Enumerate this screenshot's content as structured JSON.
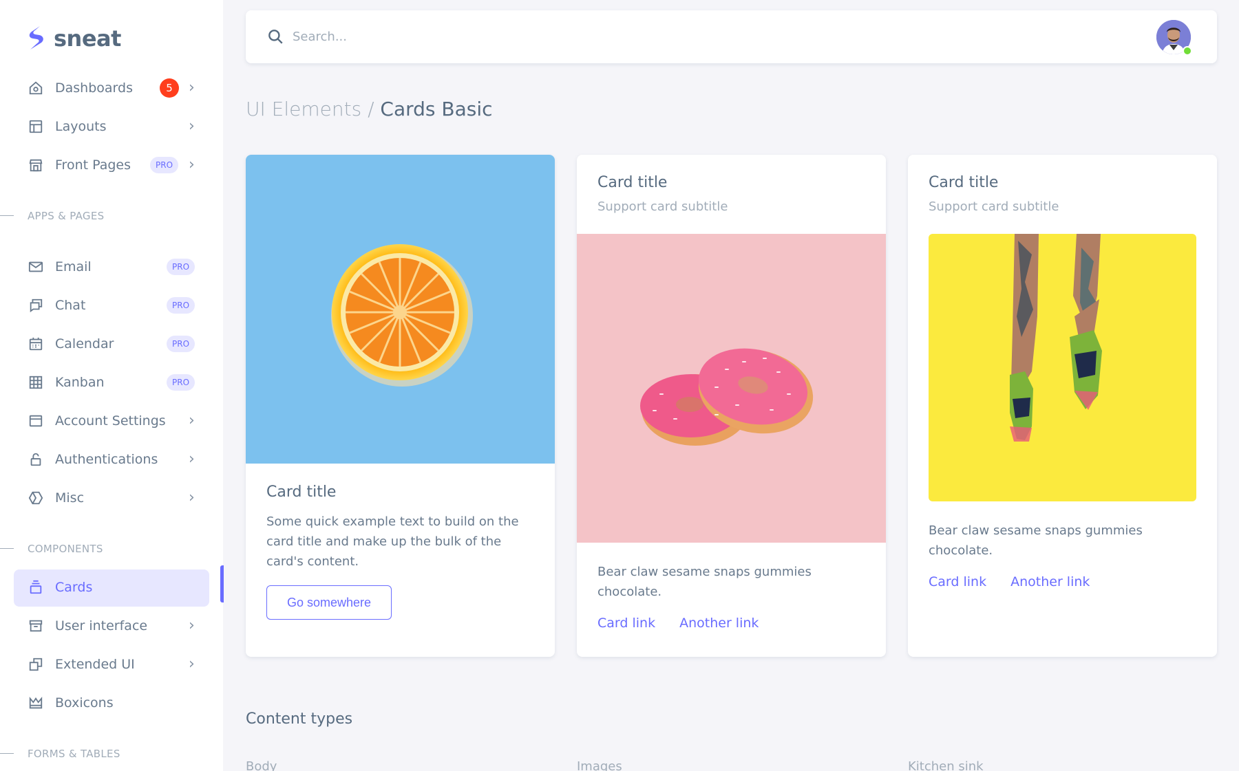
{
  "brand": {
    "name": "sneat",
    "color": "#696cff"
  },
  "search": {
    "placeholder": "Search..."
  },
  "breadcrumb": {
    "parent": "UI Elements /",
    "current": "Cards Basic"
  },
  "sidebar": {
    "group1": [
      {
        "label": "Dashboards",
        "icon": "home-icon",
        "badge": "5"
      },
      {
        "label": "Layouts",
        "icon": "layout-icon"
      },
      {
        "label": "Front Pages",
        "icon": "store-icon",
        "pro": "PRO"
      }
    ],
    "section_apps": "APPS & PAGES",
    "group2": [
      {
        "label": "Email",
        "icon": "envelope-icon",
        "pro": "PRO"
      },
      {
        "label": "Chat",
        "icon": "chat-icon",
        "pro": "PRO"
      },
      {
        "label": "Calendar",
        "icon": "calendar-icon",
        "pro": "PRO"
      },
      {
        "label": "Kanban",
        "icon": "grid-icon",
        "pro": "PRO"
      },
      {
        "label": "Account Settings",
        "icon": "window-icon"
      },
      {
        "label": "Authentications",
        "icon": "lock-icon"
      },
      {
        "label": "Misc",
        "icon": "cube-icon"
      }
    ],
    "section_components": "COMPONENTS",
    "group3": [
      {
        "label": "Cards",
        "icon": "cards-icon",
        "active": true
      },
      {
        "label": "User interface",
        "icon": "box-icon"
      },
      {
        "label": "Extended UI",
        "icon": "copy-icon"
      },
      {
        "label": "Boxicons",
        "icon": "crown-icon"
      }
    ],
    "section_forms": "FORMS & TABLES"
  },
  "cards": [
    {
      "title": "Card title",
      "text": "Some quick example text to build on the card title and make up the bulk of the card's content.",
      "button": "Go somewhere",
      "image": "orange-slice"
    },
    {
      "title": "Card title",
      "subtitle": "Support card subtitle",
      "text": "Bear claw sesame snaps gummies chocolate.",
      "link1": "Card link",
      "link2": "Another link",
      "image": "donuts"
    },
    {
      "title": "Card title",
      "subtitle": "Support card subtitle",
      "text": "Bear claw sesame snaps gummies chocolate.",
      "link1": "Card link",
      "link2": "Another link",
      "image": "sneakers"
    }
  ],
  "content_types": {
    "heading": "Content types",
    "columns": [
      "Body",
      "Images",
      "Kitchen sink"
    ]
  }
}
